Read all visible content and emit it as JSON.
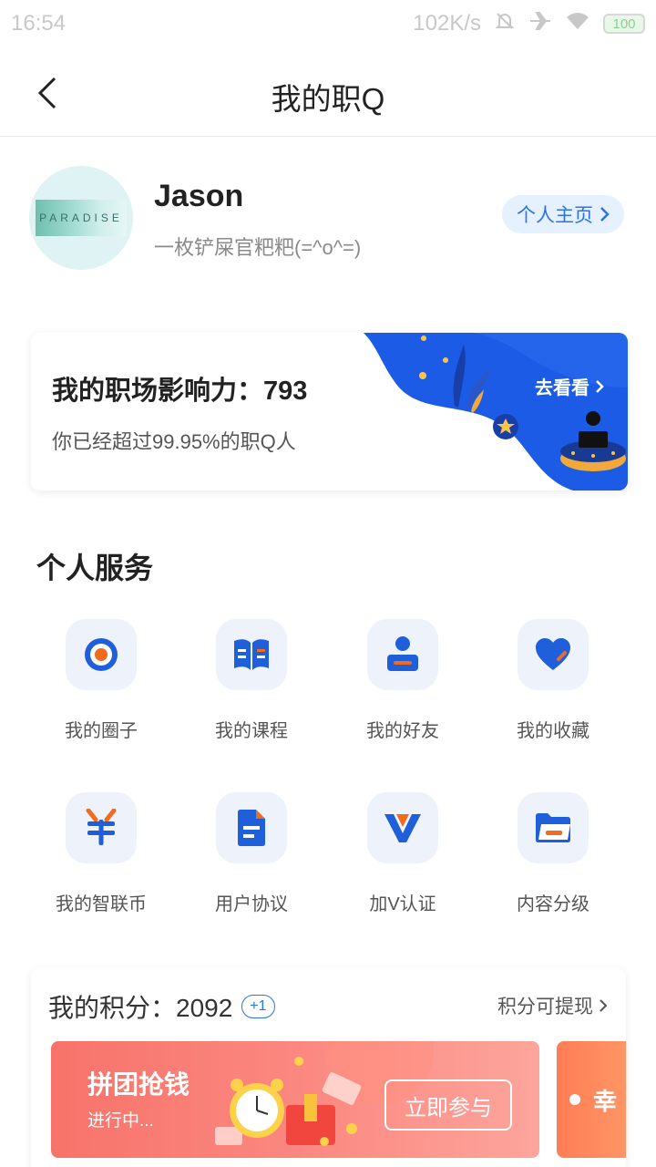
{
  "status_bar": {
    "time": "16:54",
    "speed": "102K/s",
    "battery": "100"
  },
  "nav": {
    "title": "我的职Q"
  },
  "profile": {
    "name": "Jason",
    "signature": "一枚铲屎官粑粑(=^o^=)",
    "home_button": "个人主页",
    "avatar_text": "PARADISE"
  },
  "influence": {
    "title": "我的职场影响力：793",
    "subtitle": "你已经超过99.95%的职Q人",
    "link": "去看看"
  },
  "services": {
    "title": "个人服务",
    "items": [
      {
        "label": "我的圈子",
        "icon": "target-icon"
      },
      {
        "label": "我的课程",
        "icon": "book-icon"
      },
      {
        "label": "我的好友",
        "icon": "friend-icon"
      },
      {
        "label": "我的收藏",
        "icon": "heart-icon"
      },
      {
        "label": "我的智联币",
        "icon": "yuan-icon"
      },
      {
        "label": "用户协议",
        "icon": "document-icon"
      },
      {
        "label": "加V认证",
        "icon": "v-badge-icon"
      },
      {
        "label": "内容分级",
        "icon": "folder-icon"
      }
    ]
  },
  "points": {
    "title": "我的积分：2092",
    "badge": "+1",
    "withdraw": "积分可提现",
    "banner1": {
      "title": "拼团抢钱",
      "status": "进行中...",
      "button": "立即参与"
    },
    "banner2": {
      "title": "幸"
    }
  },
  "colors": {
    "accent": "#2a73e8",
    "orange": "#f26a1b",
    "banner_red": "#f7736a"
  }
}
